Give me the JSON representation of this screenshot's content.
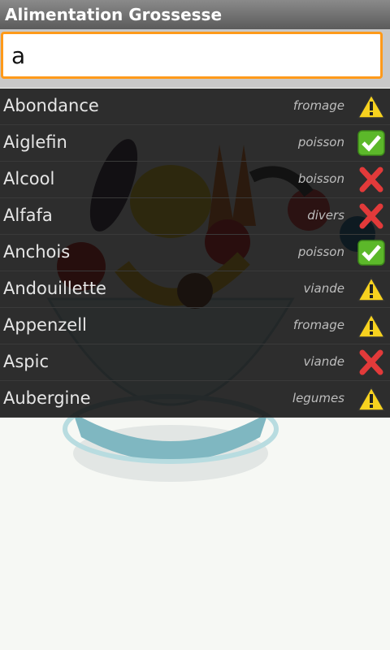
{
  "app": {
    "title": "Alimentation Grossesse"
  },
  "search": {
    "value": "a"
  },
  "rows": [
    {
      "name": "Abondance",
      "category": "fromage",
      "status": "warning"
    },
    {
      "name": "Aiglefin",
      "category": "poisson",
      "status": "ok"
    },
    {
      "name": "Alcool",
      "category": "boisson",
      "status": "forbidden"
    },
    {
      "name": "Alfafa",
      "category": "divers",
      "status": "forbidden"
    },
    {
      "name": "Anchois",
      "category": "poisson",
      "status": "ok"
    },
    {
      "name": "Andouillette",
      "category": "viande",
      "status": "warning"
    },
    {
      "name": "Appenzell",
      "category": "fromage",
      "status": "warning"
    },
    {
      "name": "Aspic",
      "category": "viande",
      "status": "forbidden"
    },
    {
      "name": "Aubergine",
      "category": "legumes",
      "status": "warning"
    }
  ],
  "colors": {
    "accent": "#ff9a1a",
    "ok": "#5cb82a",
    "warning": "#f7d21f",
    "forbidden": "#e23a3a"
  }
}
